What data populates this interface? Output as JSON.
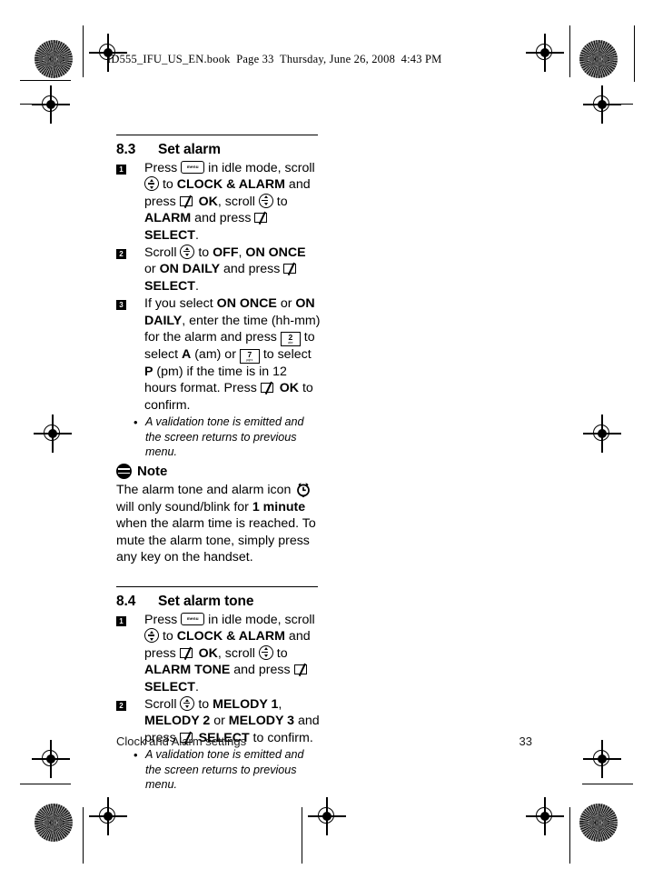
{
  "print_header": "ID555_IFU_US_EN.book  Page 33  Thursday, June 26, 2008  4:43 PM",
  "sections": [
    {
      "number": "8.3",
      "title": "Set alarm",
      "steps": [
        {
          "badge": "1",
          "parts": [
            {
              "t": "text",
              "v": "Press "
            },
            {
              "t": "key_menu",
              "v": "menu"
            },
            {
              "t": "text",
              "v": "  in idle mode, scroll "
            },
            {
              "t": "key_nav",
              "v": "scroll-updown-key"
            },
            {
              "t": "text",
              "v": " to "
            },
            {
              "t": "bold",
              "v": "CLOCK & ALARM"
            },
            {
              "t": "text",
              "v": " and press "
            },
            {
              "t": "key_soft",
              "v": "softkey"
            },
            {
              "t": "bold",
              "v": "OK"
            },
            {
              "t": "text",
              "v": ", scroll "
            },
            {
              "t": "key_nav",
              "v": "scroll-updown-key"
            },
            {
              "t": "text",
              "v": " to "
            },
            {
              "t": "bold",
              "v": "ALARM"
            },
            {
              "t": "text",
              "v": " and press "
            },
            {
              "t": "key_soft",
              "v": "softkey"
            },
            {
              "t": "bold",
              "v": "SELECT"
            },
            {
              "t": "text",
              "v": "."
            }
          ],
          "bullets": []
        },
        {
          "badge": "2",
          "parts": [
            {
              "t": "text",
              "v": "Scroll "
            },
            {
              "t": "key_nav",
              "v": "scroll-updown-key"
            },
            {
              "t": "text",
              "v": " to "
            },
            {
              "t": "bold",
              "v": "OFF"
            },
            {
              "t": "text",
              "v": ", "
            },
            {
              "t": "bold",
              "v": "ON ONCE"
            },
            {
              "t": "text",
              "v": " or "
            },
            {
              "t": "bold",
              "v": "ON DAILY"
            },
            {
              "t": "text",
              "v": " and press "
            },
            {
              "t": "key_soft",
              "v": "softkey"
            },
            {
              "t": "bold",
              "v": "SELECT"
            },
            {
              "t": "text",
              "v": "."
            }
          ],
          "bullets": []
        },
        {
          "badge": "3",
          "parts": [
            {
              "t": "text",
              "v": "If you select "
            },
            {
              "t": "bold",
              "v": "ON ONCE"
            },
            {
              "t": "text",
              "v": " or "
            },
            {
              "t": "bold",
              "v": "ON DAILY"
            },
            {
              "t": "text",
              "v": ", enter the time (hh-mm) for the alarm and press "
            },
            {
              "t": "key_digit",
              "v": "2",
              "sub": "abc"
            },
            {
              "t": "text",
              "v": " to select "
            },
            {
              "t": "bold",
              "v": "A"
            },
            {
              "t": "text",
              "v": " (am) or "
            },
            {
              "t": "key_digit",
              "v": "7",
              "sub": "pqrs"
            },
            {
              "t": "text",
              "v": " to select "
            },
            {
              "t": "bold",
              "v": "P"
            },
            {
              "t": "text",
              "v": " (pm) if the time is in 12 hours format.  Press "
            },
            {
              "t": "key_soft",
              "v": "softkey"
            },
            {
              "t": "bold",
              "v": "OK"
            },
            {
              "t": "text",
              "v": " to confirm."
            }
          ],
          "bullets": [
            "A validation tone is emitted and the screen returns to previous menu."
          ]
        }
      ],
      "note": {
        "title": "Note",
        "parts": [
          {
            "t": "text",
            "v": "The alarm tone and alarm icon "
          },
          {
            "t": "icon_alarm",
            "v": "alarm-clock-icon"
          },
          {
            "t": "text",
            "v": " will only sound/blink for "
          },
          {
            "t": "bold",
            "v": "1 minute"
          },
          {
            "t": "text",
            "v": " when the alarm time is reached. To mute the alarm tone, simply press any key on the handset."
          }
        ]
      }
    },
    {
      "number": "8.4",
      "title": "Set alarm tone",
      "steps": [
        {
          "badge": "1",
          "parts": [
            {
              "t": "text",
              "v": "Press "
            },
            {
              "t": "key_menu",
              "v": "menu"
            },
            {
              "t": "text",
              "v": "  in idle mode, scroll "
            },
            {
              "t": "key_nav",
              "v": "scroll-updown-key"
            },
            {
              "t": "text",
              "v": " to "
            },
            {
              "t": "bold",
              "v": "CLOCK & ALARM"
            },
            {
              "t": "text",
              "v": " and press "
            },
            {
              "t": "key_soft",
              "v": "softkey"
            },
            {
              "t": "bold",
              "v": "OK"
            },
            {
              "t": "text",
              "v": ", scroll "
            },
            {
              "t": "key_nav",
              "v": "scroll-updown-key"
            },
            {
              "t": "text",
              "v": " to "
            },
            {
              "t": "bold",
              "v": "ALARM TONE"
            },
            {
              "t": "text",
              "v": " and press "
            },
            {
              "t": "key_soft",
              "v": "softkey"
            },
            {
              "t": "bold",
              "v": "SELECT"
            },
            {
              "t": "text",
              "v": "."
            }
          ],
          "bullets": []
        },
        {
          "badge": "2",
          "parts": [
            {
              "t": "text",
              "v": "Scroll "
            },
            {
              "t": "key_nav",
              "v": "scroll-updown-key"
            },
            {
              "t": "text",
              "v": " to "
            },
            {
              "t": "bold",
              "v": "MELODY 1"
            },
            {
              "t": "text",
              "v": ", "
            },
            {
              "t": "bold",
              "v": "MELODY 2"
            },
            {
              "t": "text",
              "v": " or "
            },
            {
              "t": "bold",
              "v": "MELODY 3"
            },
            {
              "t": "text",
              "v": " and press "
            },
            {
              "t": "key_soft",
              "v": "softkey"
            },
            {
              "t": "bold",
              "v": "SELECT"
            },
            {
              "t": "text",
              "v": " to confirm."
            }
          ],
          "bullets": [
            "A validation tone is emitted and the screen returns to previous menu."
          ]
        }
      ],
      "note": null
    }
  ],
  "footer": {
    "chapter": "Clock and Alarm settings",
    "page_number": "33"
  },
  "bullet_glyph": "•"
}
